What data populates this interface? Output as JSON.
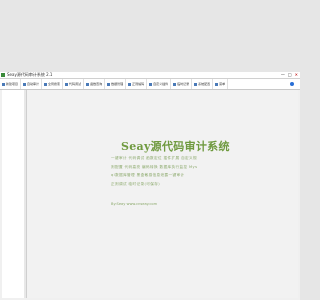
{
  "window": {
    "title": "Seay源代码审计系统 2.1",
    "controls": {
      "minimize": "—",
      "maximize": "□",
      "close": "✕"
    }
  },
  "menubar": {
    "items": [
      {
        "label": "新建项目",
        "icon": "new-project-icon"
      },
      {
        "label": "自动审计",
        "icon": "audit-icon"
      },
      {
        "label": "全局搜索",
        "icon": "search-icon"
      },
      {
        "label": "代码调试",
        "icon": "debug-icon"
      },
      {
        "label": "函数查询",
        "icon": "function-icon"
      },
      {
        "label": "数据管理",
        "icon": "database-icon"
      },
      {
        "label": "正则编码",
        "icon": "regex-icon"
      },
      {
        "label": "自定义插件",
        "icon": "plugin-icon"
      },
      {
        "label": "临时记录",
        "icon": "notes-icon"
      },
      {
        "label": "系统配置",
        "icon": "settings-icon"
      },
      {
        "label": "菜单",
        "icon": "menu-icon"
      }
    ],
    "help_icon": "help-icon"
  },
  "main": {
    "title": "Seay源代码审计系统",
    "features": [
      "一键审计  代码调试  函数定位  插件扩展  自定义规",
      "则配置  代码高亮  编码转换  数据库执行监控  Mys",
      "ql数据库管理  黑盒敏感信息泄露一键审计  ",
      "正则调试  临时记录(可保存)"
    ],
    "contact": "By:Seay  www.cnseay.com"
  },
  "colors": {
    "accent": "#6f9a3f",
    "feature_text": "#8aa86a",
    "help": "#2a6fd6"
  }
}
